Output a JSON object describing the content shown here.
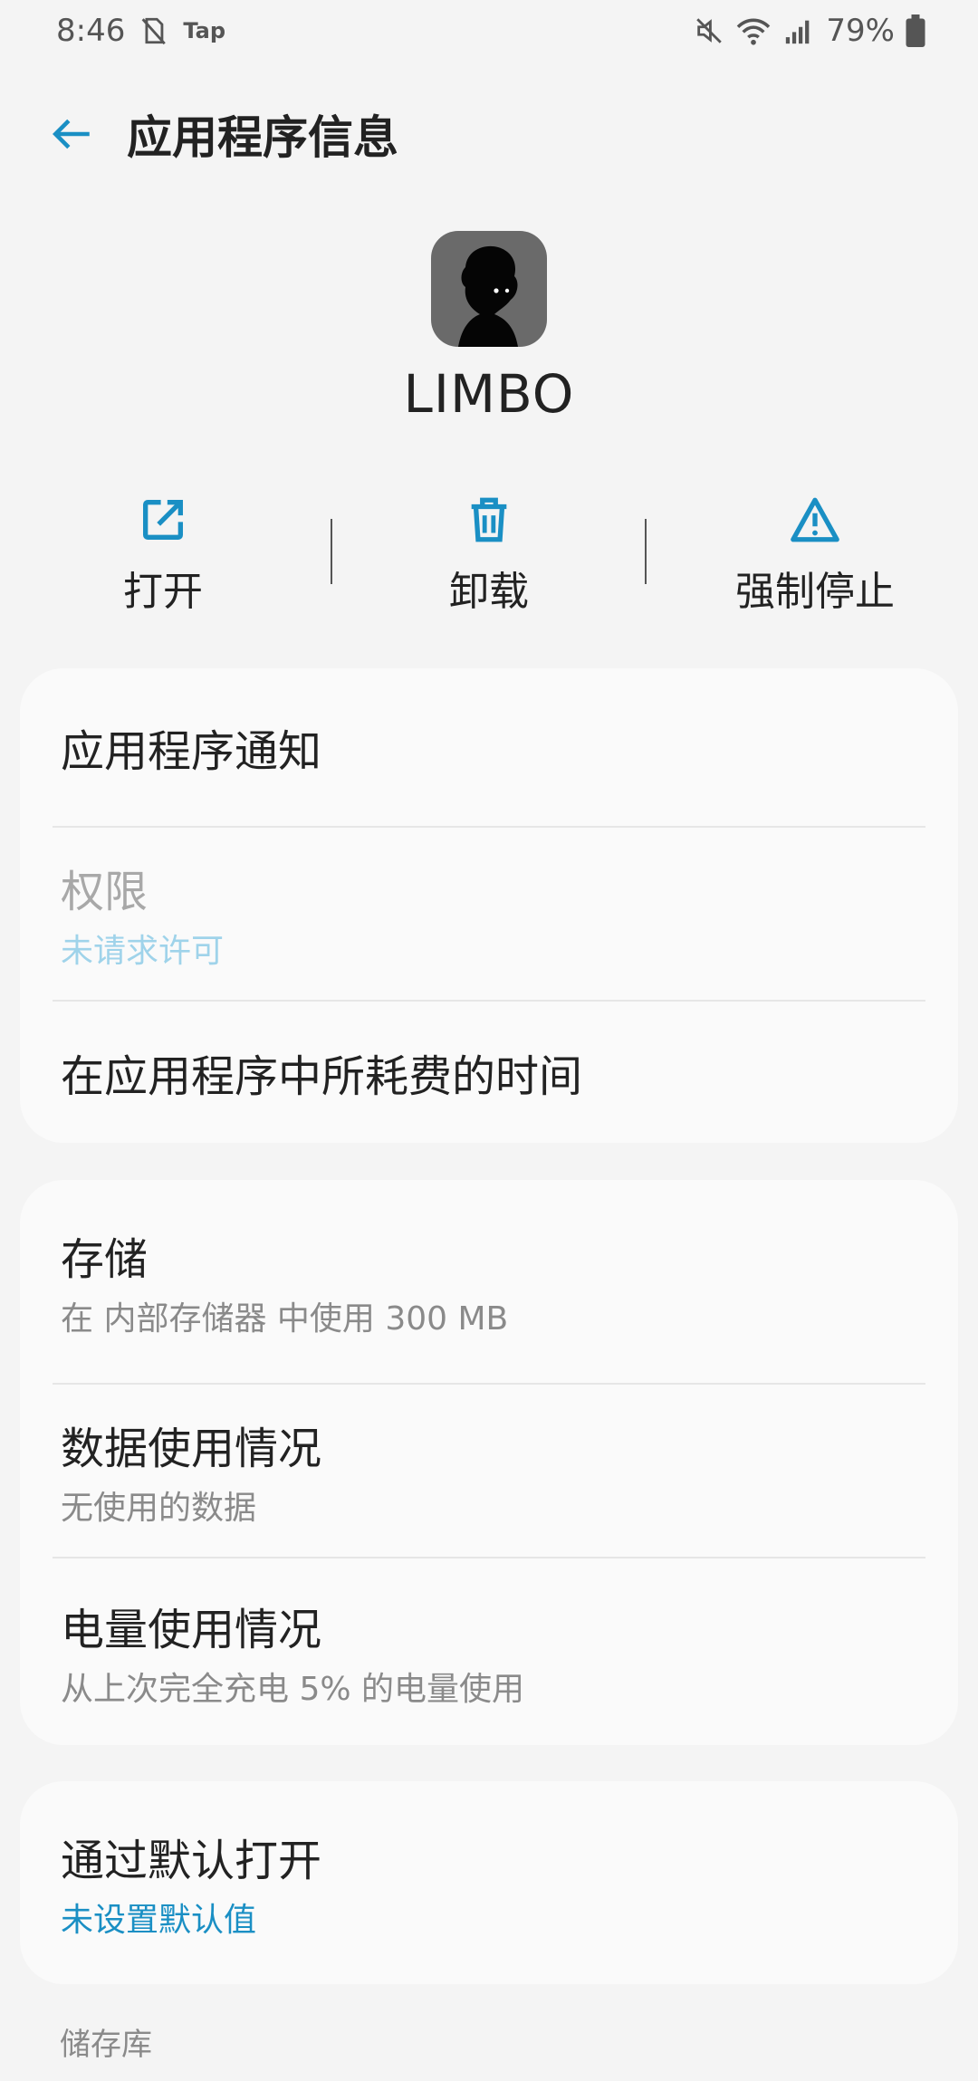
{
  "status_bar": {
    "time": "8:46",
    "tap_label": "Tap",
    "battery_percent": "79%",
    "icons": [
      "no-sim-icon",
      "mute-icon",
      "wifi-icon",
      "signal-icon",
      "battery-icon"
    ]
  },
  "app_bar": {
    "title": "应用程序信息",
    "back_icon": "arrow-left-icon"
  },
  "app": {
    "name": "LIMBO"
  },
  "actions": [
    {
      "label": "打开",
      "icon": "open-external-icon"
    },
    {
      "label": "卸载",
      "icon": "trash-icon"
    },
    {
      "label": "强制停止",
      "icon": "warning-icon"
    }
  ],
  "card1": {
    "notifications": {
      "title": "应用程序通知"
    },
    "permissions": {
      "title": "权限",
      "subtitle": "未请求许可"
    },
    "screen_time": {
      "title": "在应用程序中所耗费的时间"
    }
  },
  "card2": {
    "storage": {
      "title": "存储",
      "subtitle": "在 内部存储器 中使用 300 MB"
    },
    "data_usage": {
      "title": "数据使用情况",
      "subtitle": "无使用的数据"
    },
    "battery": {
      "title": "电量使用情况",
      "subtitle": "从上次完全充电 5% 的电量使用"
    }
  },
  "card3": {
    "open_by_default": {
      "title": "通过默认打开",
      "subtitle": "未设置默认值"
    }
  },
  "section_header": "储存库",
  "colors": {
    "accent": "#1a8fc4",
    "background": "#f4f4f4",
    "card": "#fafafa"
  }
}
